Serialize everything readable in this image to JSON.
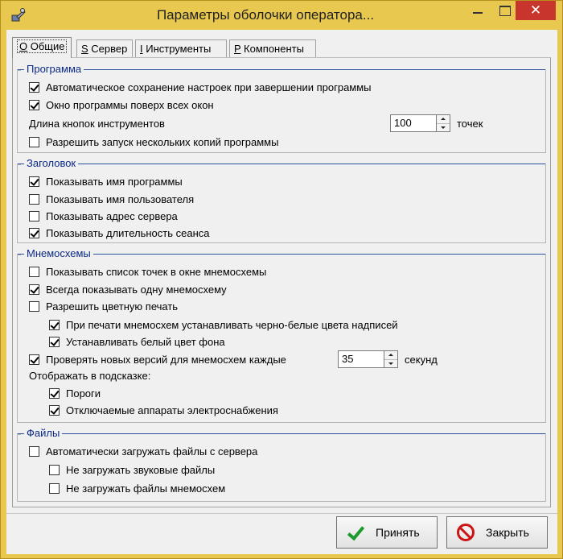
{
  "window": {
    "title": "Параметры оболочки оператора...",
    "close_glyph": "✕",
    "colors": {
      "frame": "#e8c84f",
      "close": "#c7352c",
      "group_title": "#0b2a86"
    }
  },
  "tabs": [
    {
      "key": "О",
      "label": " Общие"
    },
    {
      "key": "S",
      "label": " Сервер"
    },
    {
      "key": "I",
      "label": " Инструменты"
    },
    {
      "key": "P",
      "label": " Компоненты"
    }
  ],
  "program": {
    "title": "Программа",
    "autosave": {
      "label": "Автоматическое сохранение настроек при завершении программы",
      "checked": true
    },
    "on_top": {
      "label": "Окно программы поверх всех окон",
      "checked": true
    },
    "button_length": {
      "label": "Длина кнопок инструментов",
      "value": "100",
      "unit": "точек"
    },
    "multi_instance": {
      "label": "Разрешить запуск нескольких копий программы",
      "checked": false
    }
  },
  "header": {
    "title": "Заголовок",
    "show_program_name": {
      "label": "Показывать имя программы",
      "checked": true
    },
    "show_user_name": {
      "label": "Показывать имя пользователя",
      "checked": false
    },
    "show_server_address": {
      "label": "Показывать адрес сервера",
      "checked": false
    },
    "show_session_duration": {
      "label": "Показывать длительность сеанса",
      "checked": true
    }
  },
  "schemes": {
    "title": "Мнемосхемы",
    "show_points_list": {
      "label": "Показывать список точек в окне мнемосхемы",
      "checked": false
    },
    "always_one": {
      "label": "Всегда показывать одну мнемосхему",
      "checked": true
    },
    "color_print": {
      "label": "Разрешить цветную печать",
      "checked": false
    },
    "bw_labels": {
      "label": "При печати мнемосхем устанавливать черно-белые цвета надписей",
      "checked": true
    },
    "white_bg": {
      "label": "Устанавливать белый цвет фона",
      "checked": true
    },
    "check_versions": {
      "label": "Проверять новых версий для мнемосхем каждые",
      "checked": true,
      "value": "35",
      "unit": "секунд"
    },
    "tooltip_label": "Отображать в подсказке:",
    "thresholds": {
      "label": "Пороги",
      "checked": true
    },
    "disconnected": {
      "label": "Отключаемые аппараты электроснабжения",
      "checked": true
    }
  },
  "files": {
    "title": "Файлы",
    "auto_load": {
      "label": "Автоматически загружать файлы с сервера",
      "checked": false
    },
    "no_sound": {
      "label": "Не загружать звуковые файлы",
      "checked": false
    },
    "no_schemes": {
      "label": "Не загружать файлы мнемосхем",
      "checked": false
    }
  },
  "buttons": {
    "accept": "Принять",
    "close": "Закрыть"
  }
}
